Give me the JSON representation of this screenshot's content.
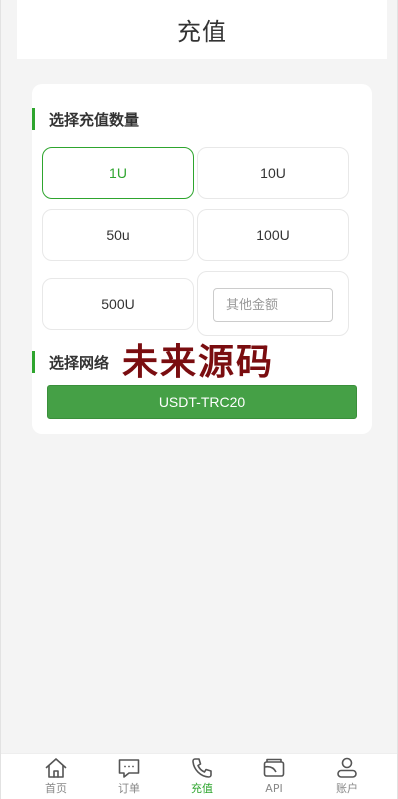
{
  "header": {
    "title": "充值"
  },
  "amount_section": {
    "title": "选择充值数量",
    "options": [
      "1U",
      "10U",
      "50u",
      "100U",
      "500U"
    ],
    "selected": "1U",
    "other_placeholder": "其他金额",
    "other_value": ""
  },
  "network_section": {
    "title": "选择网络",
    "network_label": "USDT-TRC20"
  },
  "watermark": "未来源码",
  "tabbar": {
    "items": [
      {
        "label": "首页",
        "icon": "home-icon"
      },
      {
        "label": "订单",
        "icon": "chat-icon"
      },
      {
        "label": "充值",
        "icon": "phone-icon",
        "active": true
      },
      {
        "label": "API",
        "icon": "wallet-icon"
      },
      {
        "label": "账户",
        "icon": "user-icon"
      }
    ]
  },
  "colors": {
    "accent": "#2ea52e",
    "button": "#45a046",
    "watermark": "#7a0d10",
    "background": "#f4f4f4"
  }
}
